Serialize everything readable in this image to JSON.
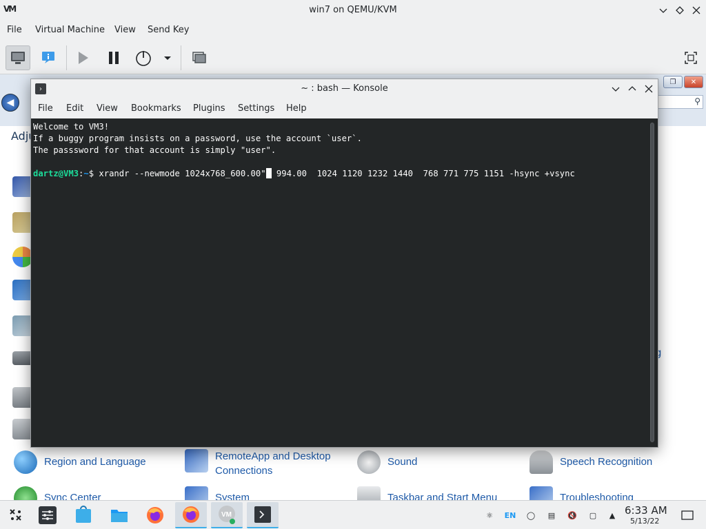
{
  "vmm": {
    "logo": "VM",
    "title": "win7 on QEMU/KVM",
    "menu": [
      "File",
      "Virtual Machine",
      "View",
      "Send Key"
    ]
  },
  "guest": {
    "adjust_label": "Adju",
    "items": [
      {
        "label_1": "Region and Language",
        "label_2": ""
      },
      {
        "label_1": "RemoteApp and Desktop",
        "label_2": "Connections"
      },
      {
        "label_1": "Sound",
        "label_2": ""
      },
      {
        "label_1": "Speech Recognition",
        "label_2": ""
      },
      {
        "label_1": "Sync Center",
        "label_2": ""
      },
      {
        "label_1": "System",
        "label_2": ""
      },
      {
        "label_1": "Taskbar and Start Menu",
        "label_2": ""
      },
      {
        "label_1": "Troubleshooting",
        "label_2": ""
      }
    ],
    "partial_right_text": "g"
  },
  "konsole": {
    "title": "~ : bash — Konsole",
    "menu": [
      "File",
      "Edit",
      "View",
      "Bookmarks",
      "Plugins",
      "Settings",
      "Help"
    ],
    "lines": [
      "Welcome to VM3!",
      "If a buggy program insists on a password, use the account `user`.",
      "The passsword for that account is simply \"user\".",
      ""
    ],
    "prompt_user": "dartz@VM3",
    "prompt_sep": ":",
    "prompt_path": "~",
    "prompt_dollar": "$ ",
    "command_before_cursor": "xrandr --newmode 1024x768_600.00\"",
    "command_after_cursor": " 994.00  1024 1120 1232 1440  768 771 775 1151 -hsync +vsync"
  },
  "taskbar": {
    "lang": "EN",
    "time": "6:33 AM",
    "date": "5/13/22"
  }
}
